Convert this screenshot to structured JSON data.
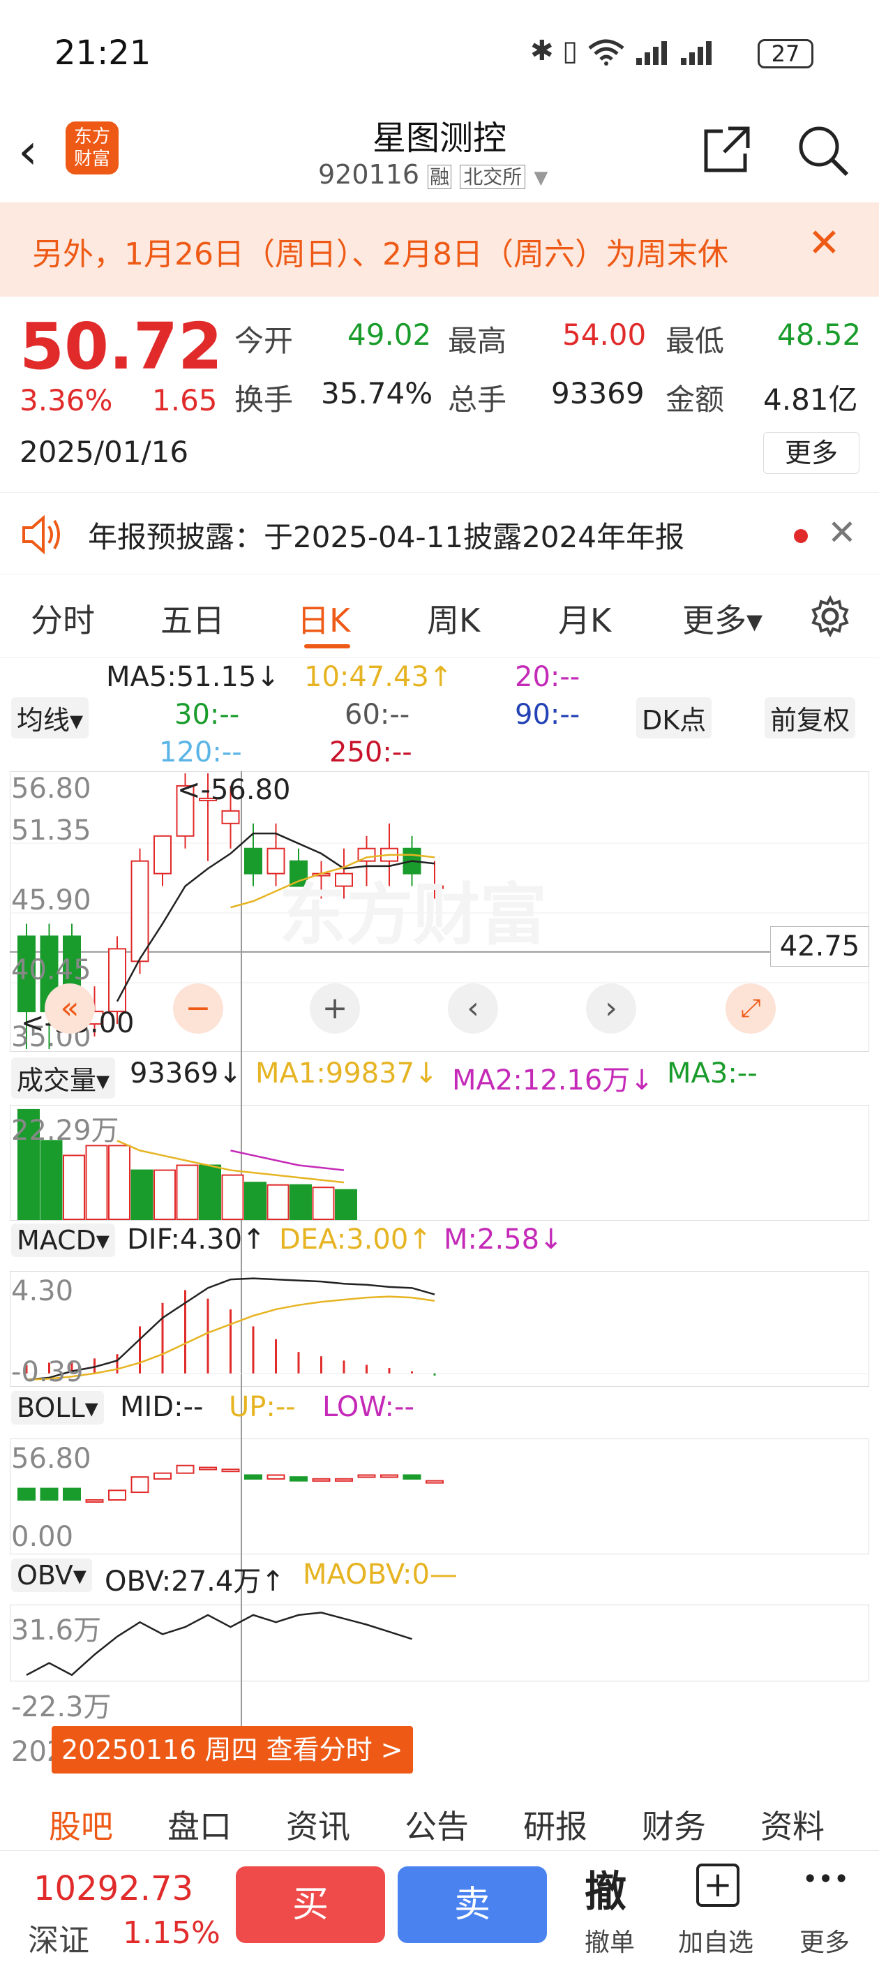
{
  "status": {
    "time": "21:21",
    "battery": "27"
  },
  "nav": {
    "title": "星图测控",
    "code": "920116",
    "tag_margin": "融",
    "tag_exchange": "北交所",
    "logo_line1": "东方",
    "logo_line2": "财富"
  },
  "banner": {
    "text": "另外，1月26日（周日）、2月8日（周六）为周末休"
  },
  "quote": {
    "price": "50.72",
    "change_pct": "3.36%",
    "change_abs": "1.65",
    "date": "2025/01/16",
    "open_label": "今开",
    "open": "49.02",
    "high_label": "最高",
    "high": "54.00",
    "low_label": "最低",
    "low": "48.52",
    "turnover_label": "换手",
    "turnover": "35.74%",
    "volume_label": "总手",
    "volume": "93369",
    "amount_label": "金额",
    "amount": "4.81亿",
    "more": "更多"
  },
  "notice": {
    "text": "年报预披露：于2025-04-11披露2024年年报"
  },
  "tabs": [
    "分时",
    "五日",
    "日K",
    "周K",
    "月K",
    "更多▾"
  ],
  "kline": {
    "ma_select": "均线▾",
    "ma5": "MA5:51.15↓",
    "ma10": "10:47.43↑",
    "ma20": "20:--",
    "ma30": "30:--",
    "ma60": "60:--",
    "ma90": "90:--",
    "ma120": "120:--",
    "ma250": "250:--",
    "dk": "DK点",
    "fq": "前复权",
    "y1": "56.80",
    "y2": "51.35",
    "y3": "45.90",
    "y4": "40.45",
    "y5": "35.00",
    "max_mark": "<-56.80",
    "min_mark": "<-35.00",
    "cross_price": "42.75",
    "watermark": "东方财富",
    "candles": [
      [
        38,
        44,
        35,
        45,
        -1
      ],
      [
        44,
        38,
        35,
        45,
        -1
      ],
      [
        38,
        44,
        37,
        45,
        -1
      ],
      [
        37,
        38,
        36,
        40,
        1
      ],
      [
        38,
        43,
        37,
        44,
        1
      ],
      [
        42,
        50,
        41,
        51,
        1
      ],
      [
        49,
        52,
        48,
        52,
        1
      ],
      [
        52,
        56,
        51,
        57,
        1
      ],
      [
        55,
        55,
        50,
        57,
        1
      ],
      [
        54,
        53,
        51,
        56,
        1
      ],
      [
        51,
        49,
        48,
        53,
        -1
      ],
      [
        49,
        51,
        48,
        53,
        1
      ],
      [
        50,
        48,
        48,
        51,
        -1
      ],
      [
        49,
        49,
        47,
        50,
        1
      ],
      [
        48,
        49,
        47,
        51,
        1
      ],
      [
        51,
        50,
        48,
        52,
        1
      ],
      [
        50,
        51,
        48,
        53,
        1
      ],
      [
        51,
        49,
        48,
        52,
        -1
      ],
      [
        48,
        48,
        47,
        50,
        1
      ]
    ],
    "ma5_line": [
      null,
      null,
      null,
      null,
      38.8,
      42.2,
      45,
      48,
      49.4,
      50.6,
      52.2,
      52.2,
      51.4,
      50.6,
      49.4,
      49.6,
      49.6,
      50,
      49.8
    ],
    "ma10_line": [
      null,
      null,
      null,
      null,
      null,
      null,
      null,
      null,
      null,
      46.3,
      46.8,
      47.6,
      48.4,
      49,
      49.5,
      50.3,
      50.5,
      50.5,
      50.3
    ]
  },
  "volume": {
    "select": "成交量▾",
    "value": "93369↓",
    "ma1": "MA1:99837↓",
    "ma2": "MA2:12.16万↓",
    "ma3": "MA3:--",
    "ymax": "22.29万",
    "bars": [
      [
        22.3,
        -1
      ],
      [
        16,
        -1
      ],
      [
        13,
        1
      ],
      [
        15,
        1
      ],
      [
        15,
        1
      ],
      [
        10,
        -1
      ],
      [
        10,
        1
      ],
      [
        11,
        1
      ],
      [
        11,
        -1
      ],
      [
        9,
        1
      ],
      [
        7.5,
        -1
      ],
      [
        7,
        1
      ],
      [
        7,
        -1
      ],
      [
        6.5,
        1
      ],
      [
        6,
        -1
      ]
    ]
  },
  "macd": {
    "select": "MACD▾",
    "dif": "DIF:4.30↑",
    "dea": "DEA:3.00↑",
    "m": "M:2.58↓",
    "ymax": "4.30",
    "ymin": "-0.39",
    "dif_line": [
      -0.3,
      -0.2,
      0.1,
      0.3,
      0.6,
      1.6,
      2.6,
      3.3,
      4.0,
      4.4,
      4.45,
      4.4,
      4.35,
      4.3,
      4.2,
      4.15,
      4.05,
      4.0,
      3.7
    ],
    "dea_line": [
      -0.3,
      -0.25,
      -0.15,
      0,
      0.2,
      0.5,
      0.9,
      1.4,
      1.9,
      2.3,
      2.7,
      3.0,
      3.2,
      3.35,
      3.45,
      3.55,
      3.6,
      3.55,
      3.4
    ],
    "bars": [
      0.4,
      0.5,
      0.6,
      0.7,
      0.9,
      2.2,
      3.3,
      3.9,
      3.5,
      3.0,
      2.2,
      1.6,
      1.0,
      0.8,
      0.6,
      0.4,
      0.25,
      0.1,
      -0.1
    ]
  },
  "boll": {
    "select": "BOLL▾",
    "mid": "MID:--",
    "up": "UP:--",
    "low": "LOW:--",
    "ymax": "56.80",
    "ymin": "0.00"
  },
  "obv": {
    "select": "OBV▾",
    "obv": "OBV:27.4万↑",
    "maobv": "MAOBV:0—",
    "ymax": "31.6万",
    "ymin": "-22.3万",
    "line": [
      -22,
      -12,
      -22,
      -5,
      10,
      22,
      12,
      18,
      28,
      18,
      28,
      22,
      28,
      30,
      25,
      20,
      14,
      8
    ]
  },
  "crosshair": {
    "date_prefix": "202",
    "label": "20250116 周四 查看分时 >"
  },
  "bottom_tabs": [
    "股吧",
    "盘口",
    "资讯",
    "公告",
    "研报",
    "财务",
    "资料"
  ],
  "footer": {
    "index_value": "10292.73",
    "index_name": "深证",
    "index_pct": "1.15%",
    "buy": "买",
    "sell": "卖",
    "cancel_icon": "撤",
    "cancel": "撤单",
    "add": "加自选",
    "more": "更多",
    "more_icon": "•••"
  },
  "colors": {
    "up": "#e12b2b",
    "down": "#1a9c2c",
    "accent": "#ee5a16",
    "sell_btn": "#4a83f0",
    "buy_btn": "#ef4b4b"
  }
}
